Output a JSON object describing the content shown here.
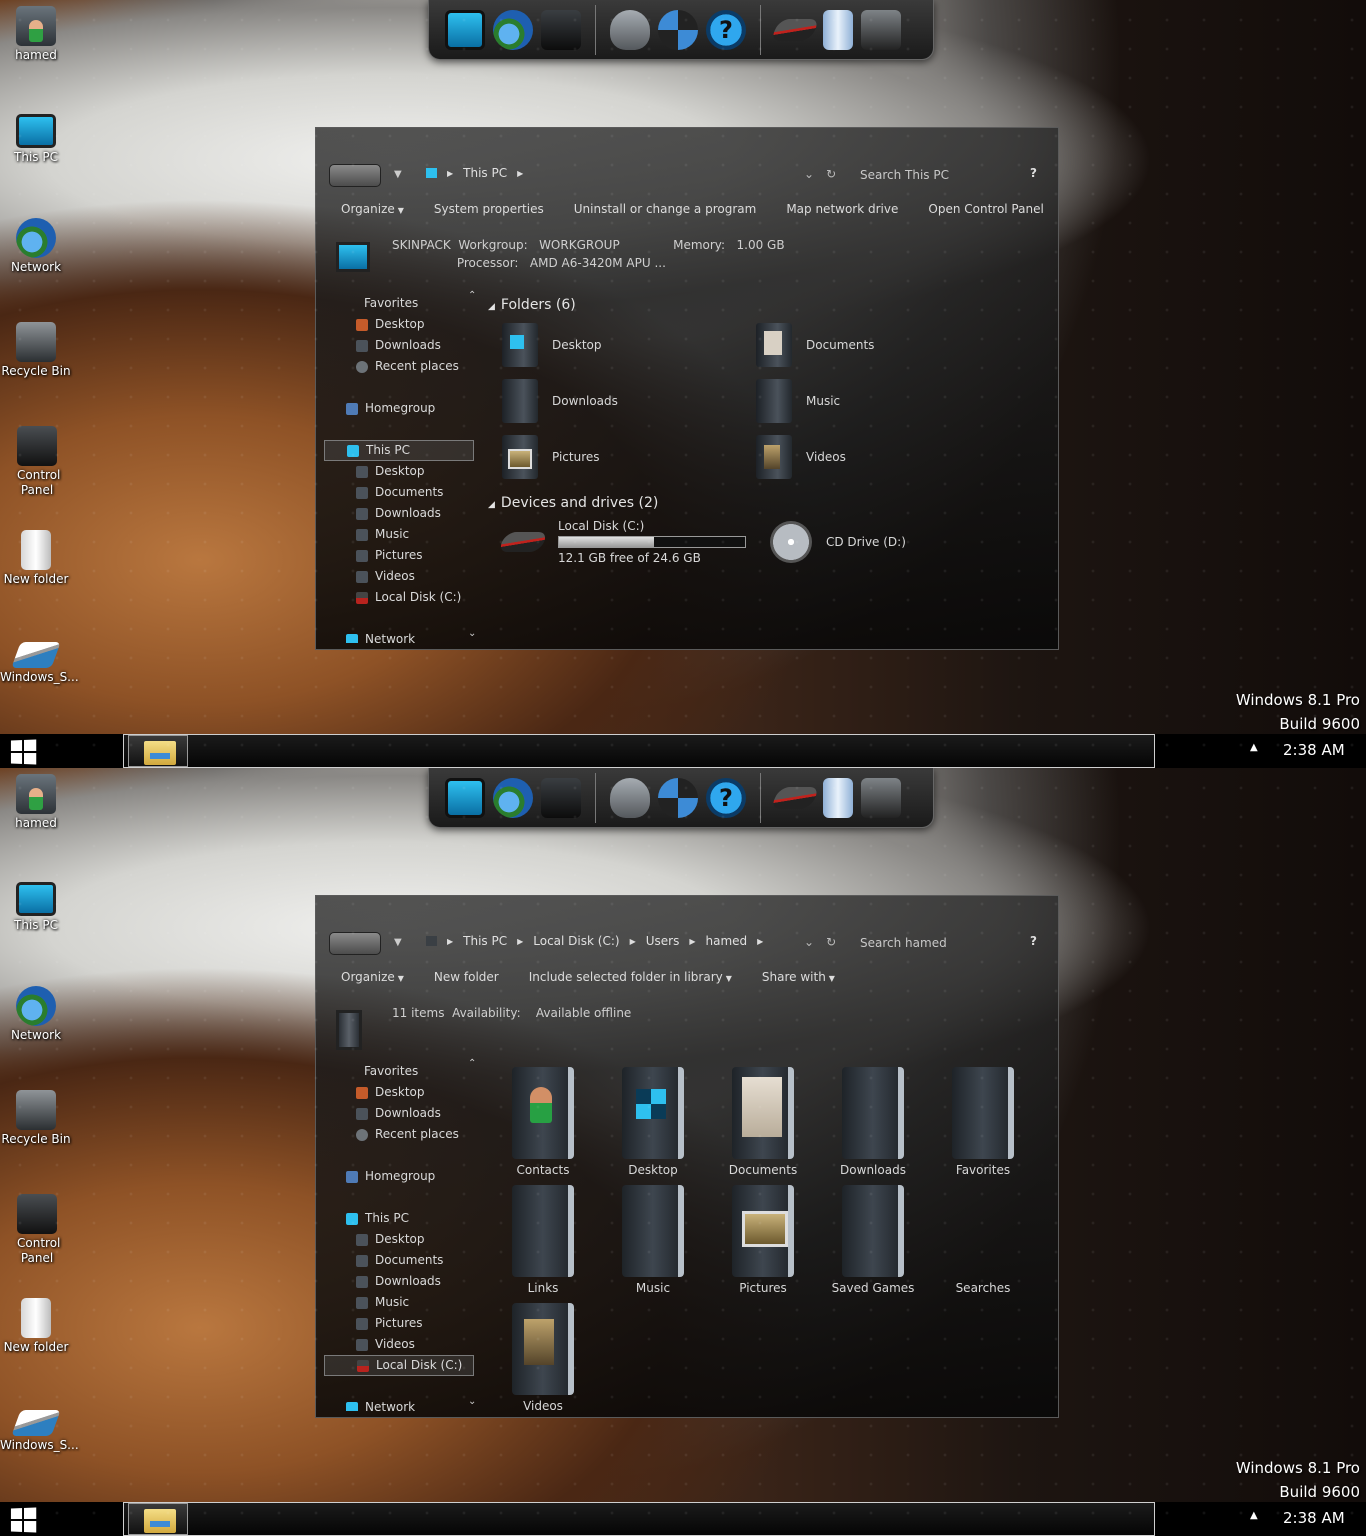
{
  "screens": [
    {
      "desktop_icons": [
        "hamed",
        "This PC",
        "Network",
        "Recycle Bin",
        "Control Panel",
        "New folder",
        "Windows_S..."
      ],
      "breadcrumb": [
        "This PC"
      ],
      "search_placeholder": "Search This PC",
      "help": "?",
      "commands": [
        "Organize",
        "System properties",
        "Uninstall or change a program",
        "Map network drive",
        "Open Control Panel"
      ],
      "info_line1": "SKINPACK  Workgroup:   WORKGROUP              Memory:   1.00 GB",
      "info_line2": "                 Processor:   AMD A6-3420M APU ...",
      "nav": {
        "favorites": "Favorites",
        "fav_items": [
          "Desktop",
          "Downloads",
          "Recent places"
        ],
        "homegroup": "Homegroup",
        "thispc": "This PC",
        "pc_items": [
          "Desktop",
          "Documents",
          "Downloads",
          "Music",
          "Pictures",
          "Videos",
          "Local Disk (C:)"
        ],
        "network": "Network"
      },
      "folders_header": "Folders (6)",
      "folders": [
        "Desktop",
        "Documents",
        "Downloads",
        "Music",
        "Pictures",
        "Videos"
      ],
      "drives_header": "Devices and drives (2)",
      "drive_c": {
        "name": "Local Disk (C:)",
        "free": "12.1 GB free of 24.6 GB",
        "used_fraction": 0.51
      },
      "drive_d": {
        "name": "CD Drive (D:)"
      }
    },
    {
      "desktop_icons": [
        "hamed",
        "This PC",
        "Network",
        "Recycle Bin",
        "Control Panel",
        "New folder",
        "Windows_S..."
      ],
      "breadcrumb": [
        "This PC",
        "Local Disk (C:)",
        "Users",
        "hamed"
      ],
      "search_placeholder": "Search hamed",
      "help": "?",
      "commands": [
        "Organize",
        "New folder",
        "Include selected folder in library",
        "Share with"
      ],
      "info_line1": "11 items  Availability:    Available offline",
      "nav": {
        "favorites": "Favorites",
        "fav_items": [
          "Desktop",
          "Downloads",
          "Recent places"
        ],
        "homegroup": "Homegroup",
        "thispc": "This PC",
        "pc_items": [
          "Desktop",
          "Documents",
          "Downloads",
          "Music",
          "Pictures",
          "Videos",
          "Local Disk (C:)"
        ],
        "network": "Network"
      },
      "items": [
        "Contacts",
        "Desktop",
        "Documents",
        "Downloads",
        "Favorites",
        "Links",
        "Music",
        "Pictures",
        "Saved Games",
        "Searches",
        "Videos"
      ]
    }
  ],
  "os": {
    "name": "Windows 8.1 Pro",
    "build": "Build 9600"
  },
  "clock": "2:38 AM",
  "tray_arrow": "▲",
  "colors": {
    "accent": "#2ec0ef",
    "drive_red": "#c0221d"
  }
}
